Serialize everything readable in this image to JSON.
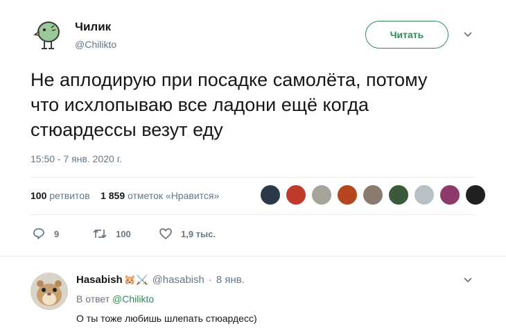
{
  "tweet": {
    "author_name": "Чилик",
    "author_handle": "@Chilikto",
    "follow_label": "Читать",
    "text": "Не аплодирую при посадке самолёта, потому что исхлопываю все ладони ещё когда стюардессы везут еду",
    "timestamp": "15:50 - 7 янв. 2020 г.",
    "retweets_count": "100",
    "retweets_label": "ретвитов",
    "likes_count": "1 859",
    "likes_label": "отметок «Нравится»",
    "liker_avatar_colors": [
      "#2b3a4a",
      "#c0392b",
      "#a9a49a",
      "#b5461f",
      "#8a7a70",
      "#3a5a3a",
      "#b8c0c8",
      "#8e3a6a",
      "#202020"
    ]
  },
  "actions": {
    "replies_count": "9",
    "retweets_count": "100",
    "likes_count": "1,9 тыс."
  },
  "reply": {
    "author_name": "Hasabish",
    "emojis": "🐹⚔️",
    "author_handle": "@hasabish",
    "separator": "·",
    "date": "8 янв.",
    "in_reply_prefix": "В ответ",
    "in_reply_handle": "@Chilikto",
    "text": "О ты тоже любишь шлепать стюардесс)"
  },
  "colors": {
    "accent": "#2e8b57",
    "muted": "#657786",
    "divider": "#e6ecf0"
  }
}
